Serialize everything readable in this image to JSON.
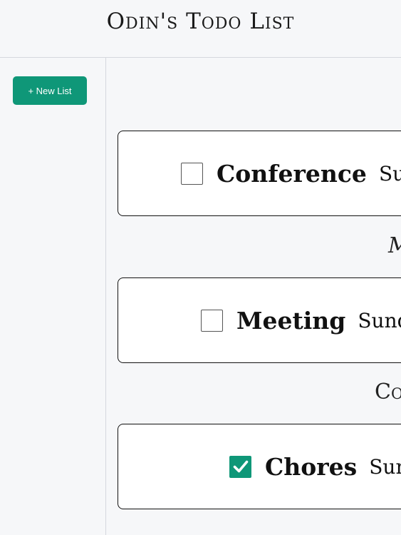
{
  "header": {
    "title": "Odin's Todo List"
  },
  "sidebar": {
    "new_list_label": "+ New List"
  },
  "todos": [
    {
      "title": "Conference",
      "date": "Sund",
      "checked": false
    },
    {
      "title": "Meeting",
      "date": "Sunday",
      "checked": false
    },
    {
      "title": "Chores",
      "date": "Sund",
      "checked": true
    }
  ],
  "between_labels": [
    "M",
    "Co"
  ],
  "colors": {
    "accent": "#0f9778",
    "background": "#f6f7f9",
    "card": "#ffffff"
  },
  "icons": {
    "check": "check-icon"
  }
}
